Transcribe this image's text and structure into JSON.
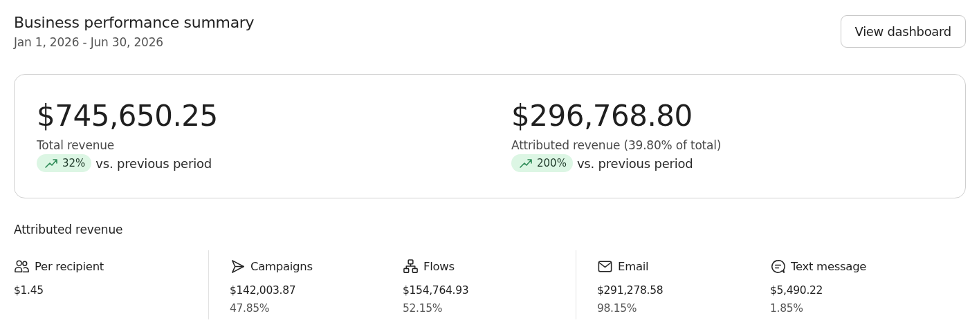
{
  "header": {
    "title": "Business performance summary",
    "date_range": "Jan 1, 2026 - Jun 30, 2026",
    "button": "View dashboard"
  },
  "summary": [
    {
      "amount": "$745,650.25",
      "label": "Total revenue",
      "rising": true,
      "change": "32%",
      "comparison": "vs. previous period"
    },
    {
      "amount": "$296,768.80",
      "label": "Attributed revenue (39.80% of total)",
      "rising": true,
      "change": "200%",
      "comparison": "vs. previous period"
    }
  ],
  "attributed": {
    "title": "Attributed revenue",
    "groups": [
      {
        "metrics": [
          {
            "kind": "people",
            "label": "Per recipient",
            "value": "$1.45"
          }
        ]
      },
      {
        "metrics": [
          {
            "kind": "send",
            "label": "Campaigns",
            "value": "$142,003.87",
            "share": "47.85%"
          },
          {
            "kind": "flow",
            "label": "Flows",
            "value": "$154,764.93",
            "share": "52.15%"
          }
        ]
      },
      {
        "metrics": [
          {
            "kind": "mail",
            "label": "Email",
            "value": "$291,278.58",
            "share": "98.15%"
          },
          {
            "kind": "chat",
            "label": "Text message",
            "value": "$5,490.22",
            "share": "1.85%"
          }
        ]
      }
    ]
  }
}
